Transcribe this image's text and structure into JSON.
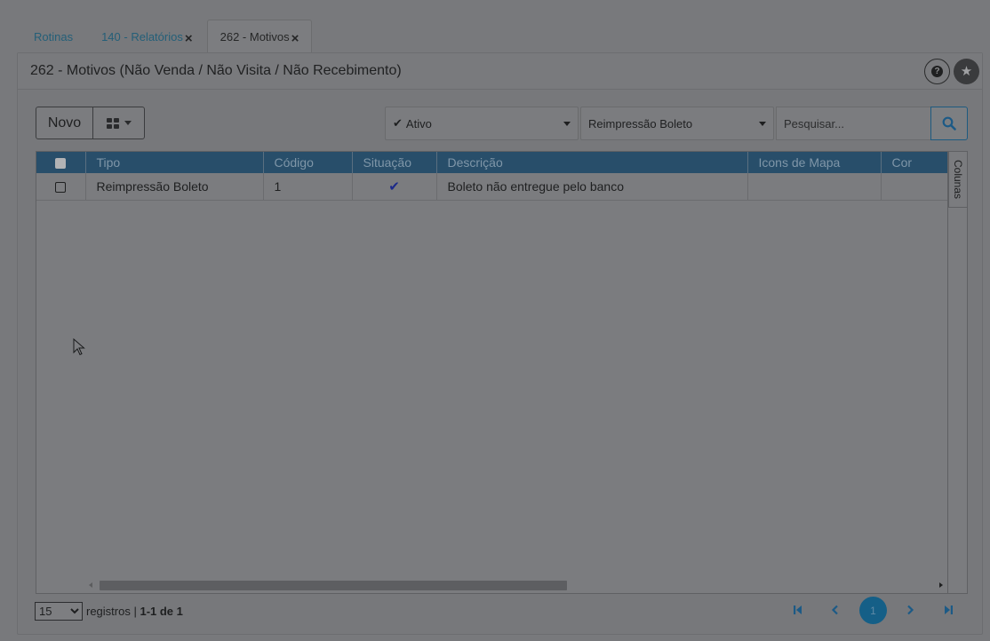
{
  "tabs": [
    {
      "label": "Rotinas"
    },
    {
      "label": "140 - Relatórios"
    },
    {
      "label": "262 - Motivos"
    }
  ],
  "tab_close_glyph": "×",
  "page_title": "262 - Motivos (Não Venda / Não Visita / Não Recebimento)",
  "header_icons": [
    "question-circle-icon",
    "star-icon"
  ],
  "toolbar": {
    "novo_label": "Novo",
    "situacao_value": "Ativo",
    "motivo_value": "Reimpressão Boleto",
    "search_placeholder": "Pesquisar..."
  },
  "table": {
    "columns": [
      "Tipo",
      "Código",
      "Situação",
      "Descrição",
      "Icons de Mapa",
      "Cor"
    ],
    "rows": [
      {
        "tipo": "Reimpressão Boleto",
        "codigo": "1",
        "situacao": "✔",
        "descricao": "Boleto não entregue pelo banco",
        "icons_mapa": "",
        "cor": ""
      }
    ]
  },
  "columns_tab_label": "Colunas",
  "footer": {
    "page_size": "15",
    "page_size_options": [
      "15"
    ],
    "registros_label": "registros",
    "range_text": "1-1 de 1",
    "current_page": "1"
  },
  "colors": {
    "accent": "#1c5a86",
    "header_bg": "#284e6a"
  }
}
